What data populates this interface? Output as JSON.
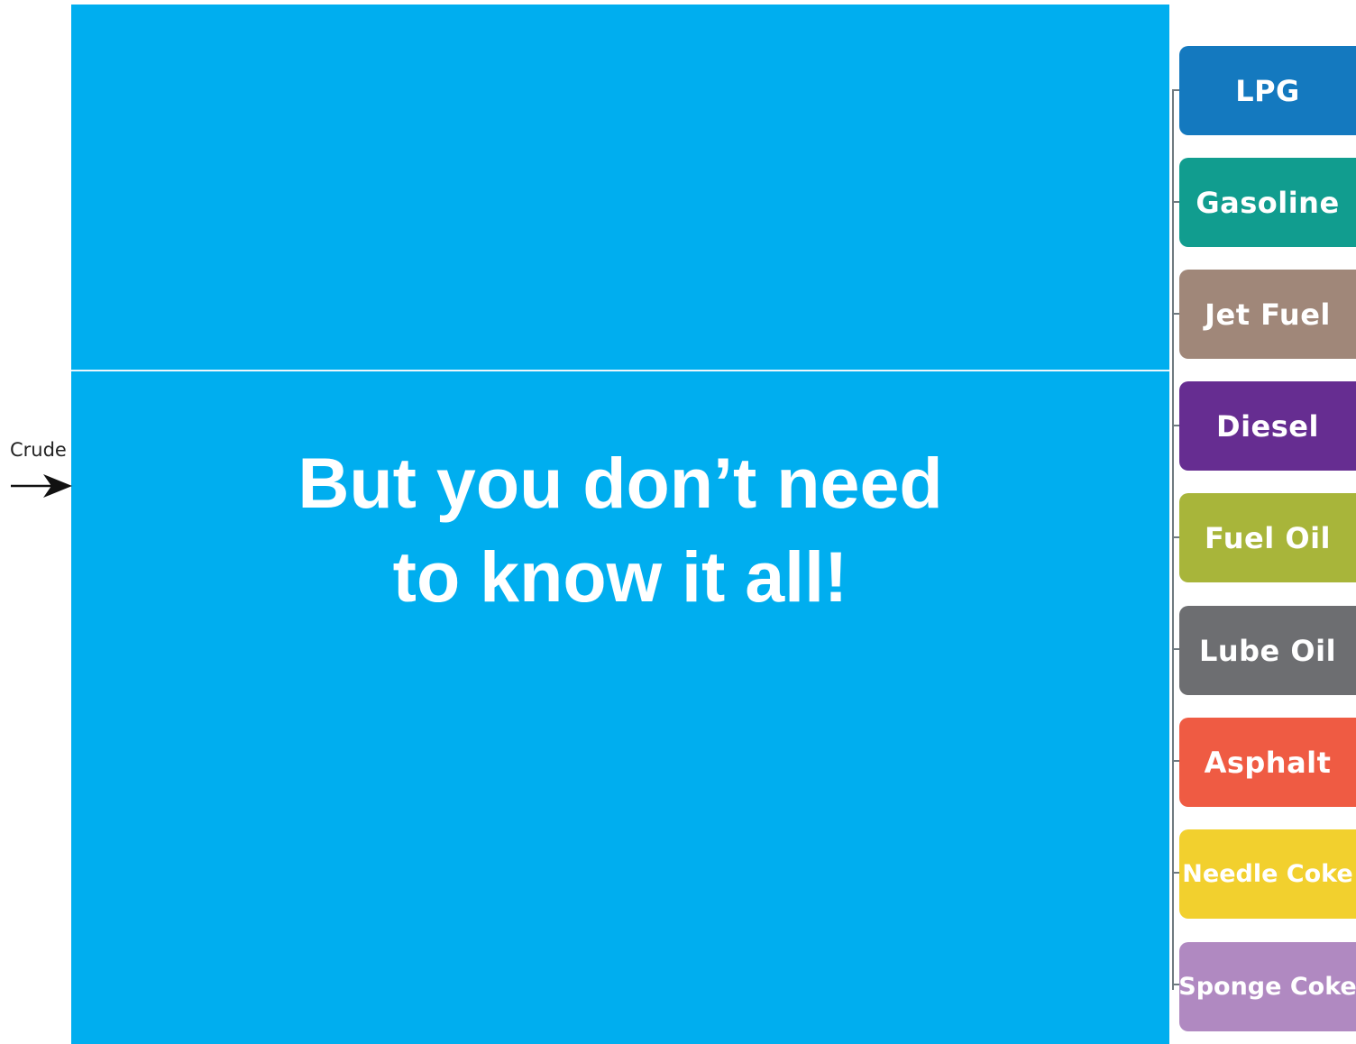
{
  "slide": {
    "headline_line1": "But you don’t need",
    "headline_line2": "to know it all!",
    "panel_color": "#00AEEF"
  },
  "input": {
    "label": "Crude",
    "icon": "arrow-right-icon"
  },
  "products": [
    {
      "label": "LPG",
      "color": "#1479BF"
    },
    {
      "label": "Gasoline",
      "color": "#119D8F"
    },
    {
      "label": "Jet Fuel",
      "color": "#A08779"
    },
    {
      "label": "Diesel",
      "color": "#662D91"
    },
    {
      "label": "Fuel Oil",
      "color": "#A8B53A"
    },
    {
      "label": "Lube Oil",
      "color": "#6D6E71"
    },
    {
      "label": "Asphalt",
      "color": "#EF5B43"
    },
    {
      "label": "Needle Coke",
      "color": "#F2D02E"
    },
    {
      "label": "Sponge Coke",
      "color": "#B089C1"
    }
  ]
}
